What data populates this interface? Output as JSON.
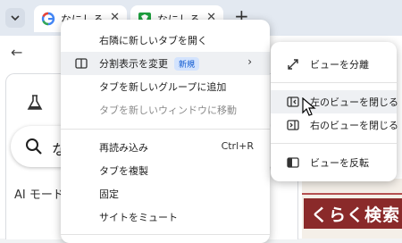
{
  "tabs": [
    {
      "title": "なにしるパ",
      "favicon": "google-g-icon"
    },
    {
      "title": "なにしるパ",
      "favicon": "green-site-icon"
    }
  ],
  "newtab_glyph": "+",
  "search": {
    "text": "な",
    "ai_label": "AI モード"
  },
  "right_page": {
    "banner_text": "くらく検索"
  },
  "context_menu": {
    "items": [
      {
        "label": "右隣に新しいタブを開く"
      },
      {
        "label": "分割表示を変更",
        "badge": "新規",
        "icon": "split-view-icon"
      },
      {
        "label": "タブを新しいグループに追加"
      },
      {
        "label": "タブを新しいウィンドウに移動"
      },
      {
        "label": "再読み込み",
        "shortcut": "Ctrl+R"
      },
      {
        "label": "タブを複製"
      },
      {
        "label": "固定"
      },
      {
        "label": "サイトをミュート"
      }
    ]
  },
  "submenu": {
    "items": [
      {
        "label": "ビューを分離",
        "icon": "detach-view-icon"
      },
      {
        "label": "左のビューを閉じる",
        "icon": "close-left-view-icon"
      },
      {
        "label": "右のビューを閉じる",
        "icon": "close-right-view-icon"
      },
      {
        "label": "ビューを反転",
        "icon": "reverse-view-icon"
      }
    ]
  },
  "colors": {
    "accent": "#0b57d0",
    "badge_bg": "#d3e3fd",
    "banner": "#8a2a2a"
  }
}
